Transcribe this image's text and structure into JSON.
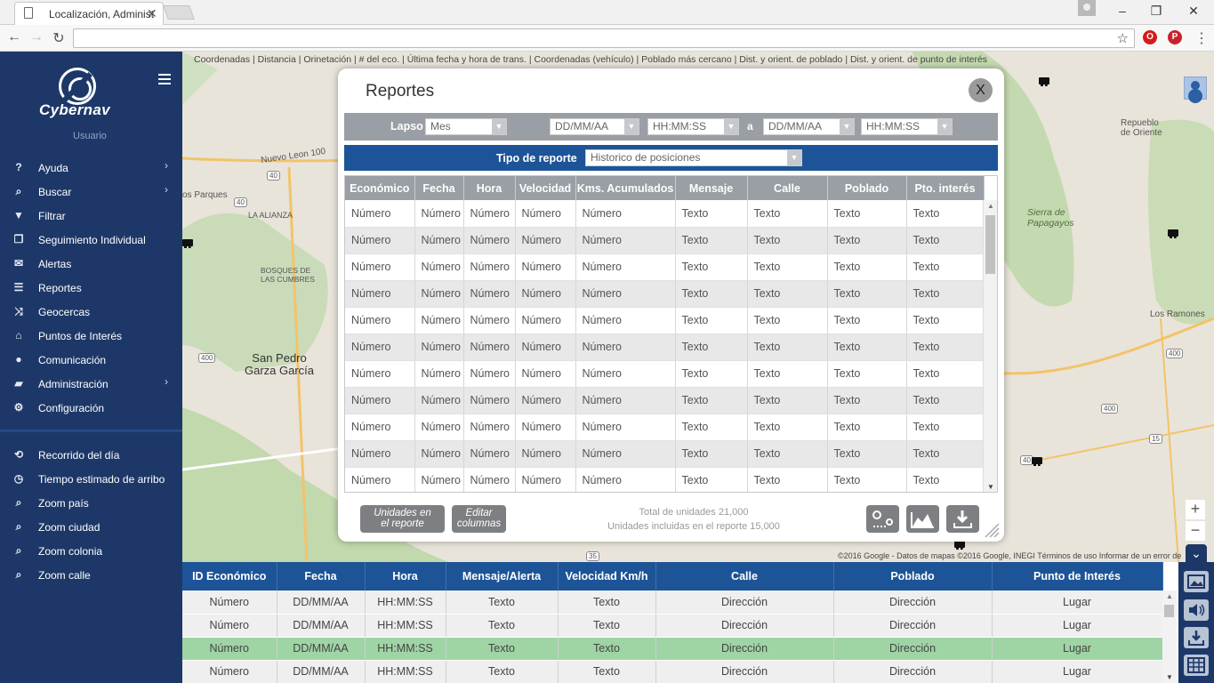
{
  "browser": {
    "tab_title": "Localización, Administrac",
    "address": ""
  },
  "sidebar": {
    "brand": "Cybernav",
    "user": "Usuario",
    "items": [
      {
        "icon": "question-icon",
        "glyph": "?",
        "label": "Ayuda",
        "arrow": "›"
      },
      {
        "icon": "search-icon",
        "glyph": "⌕",
        "label": "Buscar",
        "arrow": "›"
      },
      {
        "icon": "filter-icon",
        "glyph": "▼",
        "label": "Filtrar",
        "arrow": ""
      },
      {
        "icon": "windows-icon",
        "glyph": "❐",
        "label": "Seguimiento Individual",
        "arrow": ""
      },
      {
        "icon": "megaphone-icon",
        "glyph": "✉",
        "label": "Alertas",
        "arrow": ""
      },
      {
        "icon": "list-icon",
        "glyph": "☰",
        "label": "Reportes",
        "arrow": ""
      },
      {
        "icon": "shuffle-icon",
        "glyph": "⤨",
        "label": "Geocercas",
        "arrow": ""
      },
      {
        "icon": "bank-icon",
        "glyph": "⌂",
        "label": "Puntos de Interés",
        "arrow": ""
      },
      {
        "icon": "comment-icon",
        "glyph": "●",
        "label": "Comunicación",
        "arrow": ""
      },
      {
        "icon": "folder-icon",
        "glyph": "▰",
        "label": "Administración",
        "arrow": "›"
      },
      {
        "icon": "cogs-icon",
        "glyph": "⚙",
        "label": "Configuración",
        "arrow": ""
      }
    ],
    "tools": [
      {
        "icon": "retweet-icon",
        "glyph": "⟲",
        "label": "Recorrido del día"
      },
      {
        "icon": "clock-icon",
        "glyph": "◷",
        "label": "Tiempo estimado de arribo"
      },
      {
        "icon": "zoom-1-icon",
        "glyph": "⌕",
        "label": "Zoom país"
      },
      {
        "icon": "zoom-2-icon",
        "glyph": "⌕",
        "label": "Zoom ciudad"
      },
      {
        "icon": "zoom-3-icon",
        "glyph": "⌕",
        "label": "Zoom colonia"
      },
      {
        "icon": "zoom-4-icon",
        "glyph": "⌕",
        "label": "Zoom calle"
      }
    ]
  },
  "map": {
    "header": "Coordenadas | Distancia | Orinetación | # del eco. | Última fecha y hora de trans. | Coordenadas (vehículo) | Poblado más cercano | Dist. y orient. de poblado | Dist. y orient. de punto de interés",
    "places": {
      "nuevo_leon": "Nuevo Leon 100",
      "parques": "os Parques",
      "la_alianza": "LA ALIANZA",
      "bosques": "BOSQUES DE\nLAS CUMBRES",
      "san_pedro": "San Pedro\nGarza García",
      "repueblo": "Repueblo\nde Oriente",
      "sierra": "Sierra de\nPapagayos",
      "los_ramones": "Los Ramones",
      "r40a": "40",
      "r40b": "40",
      "r400a": "400",
      "r400b": "400",
      "r400c": "400",
      "r15": "15",
      "r35": "35",
      "r40c": "40"
    },
    "attribution": "©2016 Google - Datos de mapas ©2016 Google, INEGI    Términos de uso    Informar de un error de",
    "zoom_in": "+",
    "zoom_out": "−"
  },
  "modal": {
    "title": "Reportes",
    "close": "X",
    "lapso_label": "Lapso",
    "lapso_value": "Mes",
    "date_from": "DD/MM/AA",
    "time_from": "HH:MM:SS",
    "a_label": "a",
    "date_to": "DD/MM/AA",
    "time_to": "HH:MM:SS",
    "tipo_label": "Tipo de reporte",
    "tipo_value": "Historico de posiciones",
    "columns": [
      "Económico",
      "Fecha",
      "Hora",
      "Velocidad",
      "Kms. Acumulados",
      "Mensaje",
      "Calle",
      "Poblado",
      "Pto. interés"
    ],
    "rows": [
      [
        "Número",
        "Número",
        "Número",
        "Número",
        "Número",
        "Texto",
        "Texto",
        "Texto",
        "Texto"
      ],
      [
        "Número",
        "Número",
        "Número",
        "Número",
        "Número",
        "Texto",
        "Texto",
        "Texto",
        "Texto"
      ],
      [
        "Número",
        "Número",
        "Número",
        "Número",
        "Número",
        "Texto",
        "Texto",
        "Texto",
        "Texto"
      ],
      [
        "Número",
        "Número",
        "Número",
        "Número",
        "Número",
        "Texto",
        "Texto",
        "Texto",
        "Texto"
      ],
      [
        "Número",
        "Número",
        "Número",
        "Número",
        "Número",
        "Texto",
        "Texto",
        "Texto",
        "Texto"
      ],
      [
        "Número",
        "Número",
        "Número",
        "Número",
        "Número",
        "Texto",
        "Texto",
        "Texto",
        "Texto"
      ],
      [
        "Número",
        "Número",
        "Número",
        "Número",
        "Número",
        "Texto",
        "Texto",
        "Texto",
        "Texto"
      ],
      [
        "Número",
        "Número",
        "Número",
        "Número",
        "Número",
        "Texto",
        "Texto",
        "Texto",
        "Texto"
      ],
      [
        "Número",
        "Número",
        "Número",
        "Número",
        "Número",
        "Texto",
        "Texto",
        "Texto",
        "Texto"
      ],
      [
        "Número",
        "Número",
        "Número",
        "Número",
        "Número",
        "Texto",
        "Texto",
        "Texto",
        "Texto"
      ],
      [
        "Número",
        "Número",
        "Número",
        "Número",
        "Número",
        "Texto",
        "Texto",
        "Texto",
        "Texto"
      ]
    ],
    "btn_unidades": "Unidades en\nel reporte",
    "btn_editar": "Editar\ncolumnas",
    "total_unidades": "Total de unidades 21,000",
    "unidades_incluidas": "Unidades incluidas en el reporte 15,000"
  },
  "bottom_table": {
    "columns": [
      "ID Económico",
      "Fecha",
      "Hora",
      "Mensaje/Alerta",
      "Velocidad Km/h",
      "Calle",
      "Poblado",
      "Punto de Interés"
    ],
    "rows": [
      [
        "Número",
        "DD/MM/AA",
        "HH:MM:SS",
        "Texto",
        "Texto",
        "Dirección",
        "Dirección",
        "Lugar"
      ],
      [
        "Número",
        "DD/MM/AA",
        "HH:MM:SS",
        "Texto",
        "Texto",
        "Dirección",
        "Dirección",
        "Lugar"
      ],
      [
        "Número",
        "DD/MM/AA",
        "HH:MM:SS",
        "Texto",
        "Texto",
        "Dirección",
        "Dirección",
        "Lugar"
      ],
      [
        "Número",
        "DD/MM/AA",
        "HH:MM:SS",
        "Texto",
        "Texto",
        "Dirección",
        "Dirección",
        "Lugar"
      ]
    ],
    "highlight_row": 2
  },
  "colors": {
    "sidebar": "#1d3868",
    "header_blue": "#1d5497",
    "header_gray": "#9a9ea5",
    "highlight": "#9fd4a4"
  }
}
